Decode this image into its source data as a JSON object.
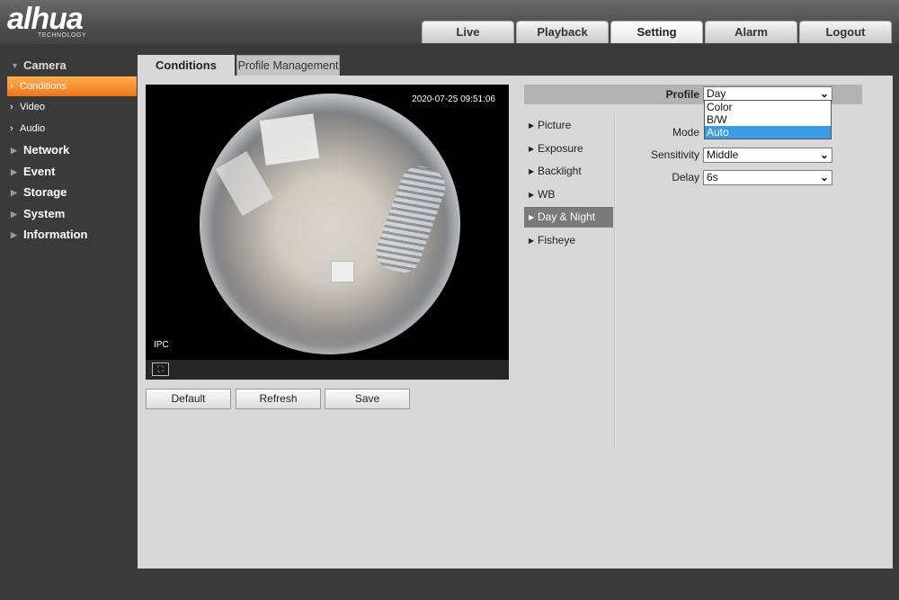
{
  "header": {
    "logo_text": "alhua",
    "logo_sub": "TECHNOLOGY",
    "nav": [
      "Live",
      "Playback",
      "Setting",
      "Alarm",
      "Logout"
    ],
    "active_nav": "Setting"
  },
  "sidebar": {
    "camera": "Camera",
    "camera_items": [
      "Conditions",
      "Video",
      "Audio"
    ],
    "groups": [
      "Network",
      "Event",
      "Storage",
      "System",
      "Information"
    ]
  },
  "subtabs": {
    "conditions": "Conditions",
    "profile_management": "Profile Management"
  },
  "video": {
    "timestamp": "2020-07-25 09:51:06",
    "channel_label": "IPC"
  },
  "buttons": {
    "default": "Default",
    "refresh": "Refresh",
    "save": "Save"
  },
  "profile": {
    "label": "Profile",
    "value": "Day",
    "options": [
      "Color",
      "B/W",
      "Auto"
    ],
    "highlighted_option": "Auto"
  },
  "menu": [
    "Picture",
    "Exposure",
    "Backlight",
    "WB",
    "Day & Night",
    "Fisheye"
  ],
  "active_menu": "Day & Night",
  "fields": {
    "mode_label": "Mode",
    "sensitivity_label": "Sensitivity",
    "sensitivity_value": "Middle",
    "delay_label": "Delay",
    "delay_value": "6s"
  },
  "colors": {
    "accent": "#f0761b",
    "highlight": "#3b9be3",
    "menu_active": "#7a7a7a"
  }
}
